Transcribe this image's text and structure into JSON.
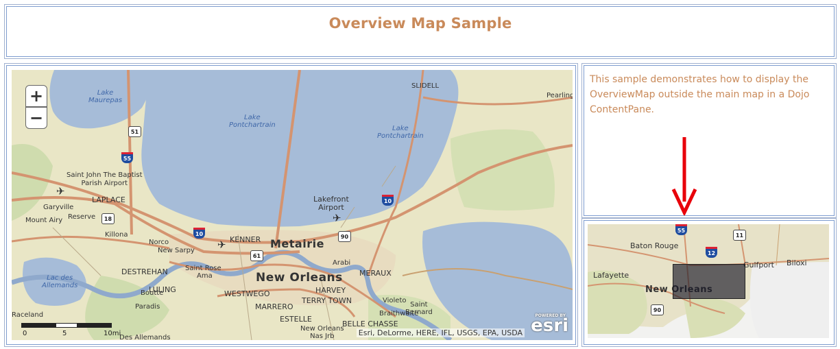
{
  "header": {
    "title": "Overview Map Sample"
  },
  "description": {
    "text": "This sample demonstrates how to display the OverviewMap outside the main map in a Dojo ContentPane."
  },
  "map": {
    "zoom_in_label": "+",
    "zoom_out_label": "−",
    "attribution": "Esri, DeLorme, HERE, IFL, USGS, EPA, USDA",
    "logo_text": "esri",
    "powered_by": "POWERED BY",
    "scalebar": {
      "tick0": "0",
      "tick1": "5",
      "tick2": "10mi"
    },
    "labels": {
      "lake_maurepas": "Lake\nMaurepas",
      "lake_pontchartrain": "Lake\nPontchartrain",
      "lake_pontchartrain_east": "Lake\nPontchartrain",
      "lac_des_allemands": "Lac des\nAllemands",
      "slidell": "SLIDELL",
      "pearlington": "Pearling",
      "airport_stjohn": "Saint John The Baptist\nParish Airport",
      "laplace": "LAPLACE",
      "garyville": "Garyville",
      "reserve": "Reserve",
      "mount_airy": "Mount Airy",
      "killona": "Killona",
      "norco": "Norco",
      "new_sarpy": "New Sarpy",
      "kenner": "KENNER",
      "metairie": "Metairie",
      "lakefront_airport": "Lakefront\nAirport",
      "saint_rose": "Saint Rose",
      "ama": "Ama",
      "destrehan": "DESTREHAN",
      "new_orleans": "New Orleans",
      "meraux": "MERAUX",
      "arabi": "Arabi",
      "luling": "LULING",
      "boutte": "Boutte",
      "paradis": "Paradis",
      "westwego": "WESTWEGO",
      "harvey": "HARVEY",
      "terrytown": "TERRY TOWN",
      "marrero": "MARRERO",
      "violet": "Violeto",
      "estelle": "ESTELLE",
      "braithwaite": "Braithwaite",
      "saint_bernard": "Saint\nBernard",
      "belle_chasse": "BELLE CHASSE",
      "new_orleans_nas": "New Orleans\nNas Jrb",
      "des_allemands": "Des Allemands",
      "raceland": "Raceland"
    },
    "shields": {
      "us51": "51",
      "i55": "55",
      "i10_west": "10",
      "i10_east": "10",
      "us61": "61",
      "us90": "90",
      "la18": "18"
    }
  },
  "overview": {
    "labels": {
      "baton_rouge": "Baton Rouge",
      "gulfport": "Gulfport",
      "biloxi": "Biloxi",
      "lafayette": "Lafayette",
      "new_orleans": "New Orleans"
    },
    "shields": {
      "i55": "55",
      "us11": "11",
      "i12": "12",
      "us90": "90"
    }
  },
  "colors": {
    "title": "#c98a5a",
    "border": "#7d9ccf",
    "water": "#a6bcd8",
    "land": "#e9e6c6",
    "road": "#d49470",
    "arrow": "#e8000a"
  }
}
